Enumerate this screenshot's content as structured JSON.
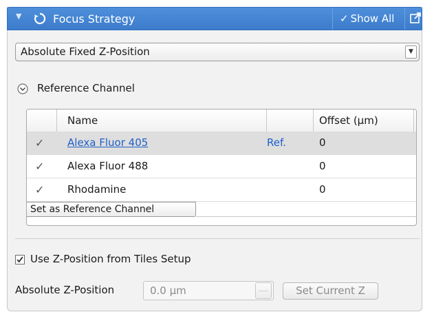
{
  "header": {
    "title": "Focus Strategy",
    "show_all_label": "Show All",
    "show_all_check": "✓",
    "collapse_icon": "triangle-down-icon",
    "refresh_icon": "refresh-icon",
    "popout_icon": "popout-icon"
  },
  "strategy_select": {
    "value": "Absolute Fixed Z-Position",
    "arrow": "▼"
  },
  "reference_channel": {
    "section_label": "Reference Channel",
    "toggle_icon": "collapse-circle-icon",
    "columns": {
      "check": "",
      "name": "Name",
      "ref": "",
      "offset": "Offset (µm)"
    },
    "rows": [
      {
        "check": "✓",
        "name": "Alexa Fluor 405",
        "ref": "Ref.",
        "offset": "0",
        "selected": true
      },
      {
        "check": "✓",
        "name": "Alexa Fluor 488",
        "ref": "",
        "offset": "0",
        "selected": false
      },
      {
        "check": "✓",
        "name": "Rhodamine",
        "ref": "",
        "offset": "0",
        "selected": false
      }
    ],
    "set_reference_label": "Set as Reference Channel"
  },
  "tiles": {
    "use_z_label": "Use Z-Position from Tiles Setup",
    "use_z_checked": true
  },
  "z_position": {
    "label": "Absolute Z-Position",
    "value": "0.0 µm",
    "set_current_label": "Set Current Z"
  },
  "colors": {
    "header_blue": "#3c7ccb",
    "link_blue": "#1e5fc8",
    "panel_bg": "#f2f2f2"
  }
}
